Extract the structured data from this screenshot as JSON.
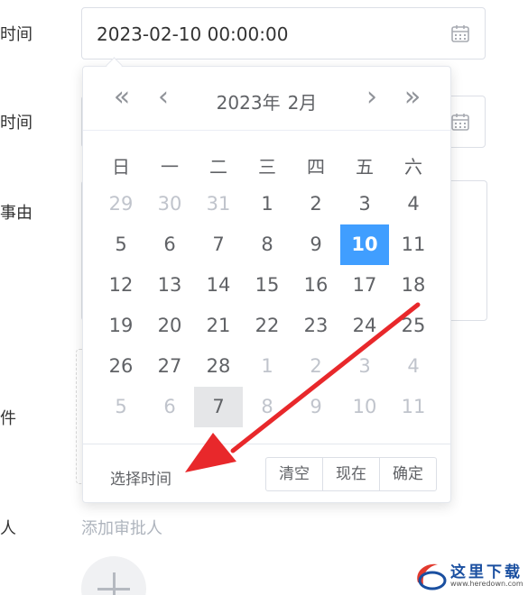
{
  "form": {
    "labels": {
      "start_time": "开始时间",
      "end_time": "结束时间",
      "reason": "请假事由",
      "attachment": "附件",
      "approver": "审批人"
    },
    "start_value": "2023-02-10 00:00:00",
    "add_approver_label": "添加审批人"
  },
  "picker": {
    "nav": {
      "prev_year": "«",
      "prev_month": "‹",
      "next_month": "›",
      "next_year": "»"
    },
    "year_label": "2023年",
    "month_label": "2月",
    "weekdays": [
      "日",
      "一",
      "二",
      "三",
      "四",
      "五",
      "六"
    ],
    "days": [
      {
        "label": "29",
        "state": "muted"
      },
      {
        "label": "30",
        "state": "muted"
      },
      {
        "label": "31",
        "state": "muted"
      },
      {
        "label": "1",
        "state": "normal"
      },
      {
        "label": "2",
        "state": "normal"
      },
      {
        "label": "3",
        "state": "normal"
      },
      {
        "label": "4",
        "state": "normal"
      },
      {
        "label": "5",
        "state": "normal"
      },
      {
        "label": "6",
        "state": "normal"
      },
      {
        "label": "7",
        "state": "normal"
      },
      {
        "label": "8",
        "state": "normal"
      },
      {
        "label": "9",
        "state": "normal"
      },
      {
        "label": "10",
        "state": "selected"
      },
      {
        "label": "11",
        "state": "normal"
      },
      {
        "label": "12",
        "state": "normal"
      },
      {
        "label": "13",
        "state": "normal"
      },
      {
        "label": "14",
        "state": "normal"
      },
      {
        "label": "15",
        "state": "normal"
      },
      {
        "label": "16",
        "state": "normal"
      },
      {
        "label": "17",
        "state": "normal"
      },
      {
        "label": "18",
        "state": "normal"
      },
      {
        "label": "19",
        "state": "normal"
      },
      {
        "label": "20",
        "state": "normal"
      },
      {
        "label": "21",
        "state": "normal"
      },
      {
        "label": "22",
        "state": "normal"
      },
      {
        "label": "23",
        "state": "normal"
      },
      {
        "label": "24",
        "state": "normal"
      },
      {
        "label": "25",
        "state": "normal"
      },
      {
        "label": "26",
        "state": "normal"
      },
      {
        "label": "27",
        "state": "normal"
      },
      {
        "label": "28",
        "state": "normal"
      },
      {
        "label": "1",
        "state": "muted"
      },
      {
        "label": "2",
        "state": "muted"
      },
      {
        "label": "3",
        "state": "muted"
      },
      {
        "label": "4",
        "state": "muted"
      },
      {
        "label": "5",
        "state": "muted"
      },
      {
        "label": "6",
        "state": "muted"
      },
      {
        "label": "7",
        "state": "today"
      },
      {
        "label": "8",
        "state": "muted"
      },
      {
        "label": "9",
        "state": "muted"
      },
      {
        "label": "10",
        "state": "muted"
      },
      {
        "label": "11",
        "state": "muted"
      }
    ],
    "footer": {
      "select_time": "选择时间",
      "clear": "清空",
      "now": "现在",
      "confirm": "确定"
    }
  },
  "colors": {
    "accent": "#409eff",
    "annotation_arrow": "#e8282b"
  },
  "watermark": {
    "text": "这里下载",
    "url": "www.heredown.com"
  }
}
